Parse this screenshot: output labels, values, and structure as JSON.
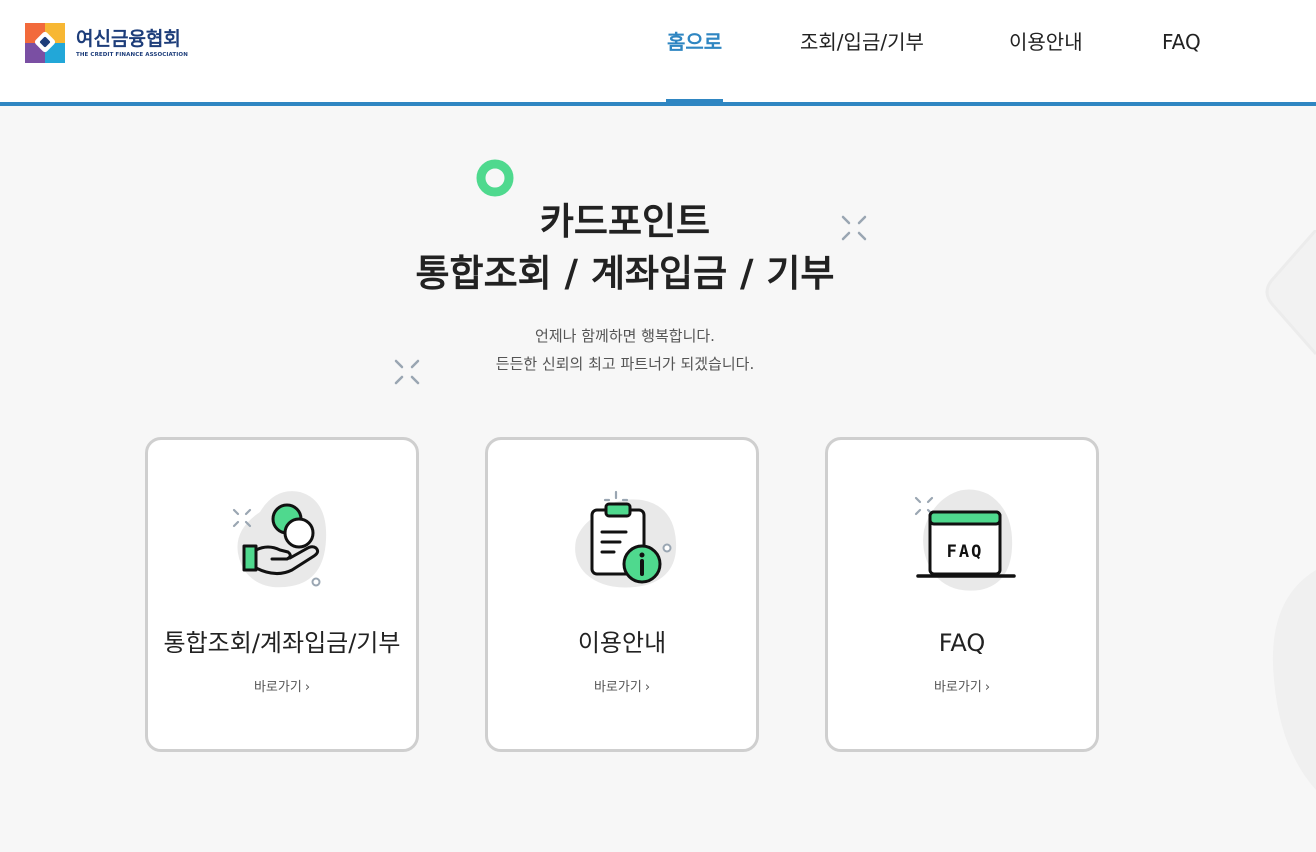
{
  "logo": {
    "name_ko": "여신금융협회",
    "name_en": "THE CREDIT FINANCE ASSOCIATION"
  },
  "nav": {
    "items": [
      {
        "label": "홈으로",
        "active": true
      },
      {
        "label": "조회/입금/기부",
        "active": false
      },
      {
        "label": "이용안내",
        "active": false
      },
      {
        "label": "FAQ",
        "active": false
      }
    ]
  },
  "hero": {
    "title_line1": "카드포인트",
    "title_line2": "통합조회 / 계좌입금 / 기부",
    "sub_line1": "언제나 함께하면 행복합니다.",
    "sub_line2": "든든한 신뢰의 최고 파트너가 되겠습니다."
  },
  "cards": [
    {
      "title": "통합조회/계좌입금/기부",
      "link": "바로가기",
      "icon": "coin-hand-icon"
    },
    {
      "title": "이용안내",
      "link": "바로가기",
      "icon": "clipboard-info-icon"
    },
    {
      "title": "FAQ",
      "link": "바로가기",
      "icon": "faq-window-icon",
      "icon_text": "FAQ"
    }
  ],
  "colors": {
    "accent": "#2f86c2",
    "green": "#4fd98e",
    "navy": "#1d3d7a",
    "background": "#f7f7f7",
    "card_border": "#cfcfcf"
  }
}
